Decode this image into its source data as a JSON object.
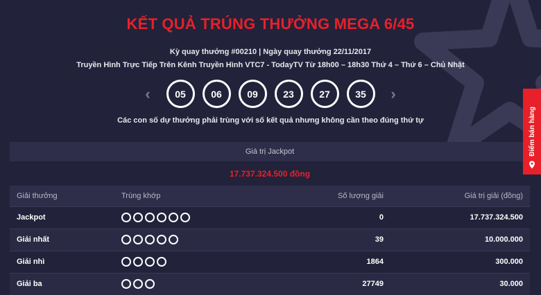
{
  "title": "KẾT QUẢ TRÚNG THƯỞNG MEGA 6/45",
  "draw_info": "Kỳ quay thưởng #00210 | Ngày quay thưởng 22/11/2017",
  "broadcast_info": "Truyền Hình Trực Tiếp Trên Kênh Truyền Hình VTC7 - TodayTV Từ 18h00 – 18h30 Thứ 4 – Thứ 6 – Chủ Nhật",
  "nav": {
    "prev_icon": "chevron-left-icon",
    "next_icon": "chevron-right-icon"
  },
  "numbers": [
    "05",
    "06",
    "09",
    "23",
    "27",
    "35"
  ],
  "note": "Các con số dự thưởng phải trùng với số kết quả nhưng không cần theo đúng thứ tự",
  "jackpot": {
    "label": "Giá trị Jackpot",
    "value": "17.737.324.500 đồng"
  },
  "table": {
    "headers": [
      "Giải thưởng",
      "Trùng khớp",
      "Số lượng giải",
      "Giá trị giải (đồng)"
    ],
    "rows": [
      {
        "prize": "Jackpot",
        "matches": 6,
        "count": "0",
        "value": "17.737.324.500"
      },
      {
        "prize": "Giải nhất",
        "matches": 5,
        "count": "39",
        "value": "10.000.000"
      },
      {
        "prize": "Giải nhì",
        "matches": 4,
        "count": "1864",
        "value": "300.000"
      },
      {
        "prize": "Giải ba",
        "matches": 3,
        "count": "27749",
        "value": "30.000"
      }
    ]
  },
  "side_tab": {
    "label": "Điểm bán hàng",
    "icon": "map-pin-icon"
  },
  "colors": {
    "accent": "#e8202a",
    "background": "#22223a",
    "panel": "#2e2e4a"
  }
}
